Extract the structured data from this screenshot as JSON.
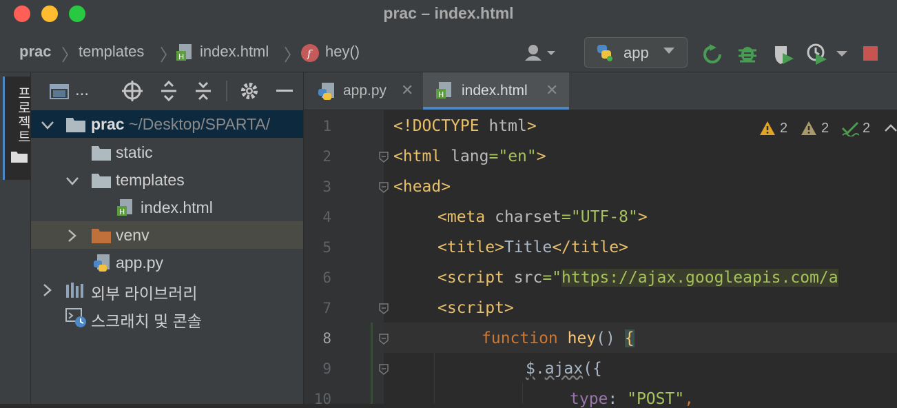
{
  "window": {
    "title": "prac – index.html"
  },
  "breadcrumb": {
    "project": "prac",
    "folder": "templates",
    "file": "index.html",
    "function": "hey()"
  },
  "run_config": {
    "label": "app"
  },
  "sidebar_strip": {
    "label": "프로젝트"
  },
  "project_panel": {
    "toolbar_dots": "...",
    "tree": [
      {
        "name": "prac",
        "path": "~/Desktop/SPARTA/"
      },
      {
        "name": "static"
      },
      {
        "name": "templates"
      },
      {
        "name": "index.html"
      },
      {
        "name": "venv"
      },
      {
        "name": "app.py"
      },
      {
        "name": "외부 라이브러리"
      },
      {
        "name": "스크래치 및 콘솔"
      }
    ]
  },
  "editor": {
    "tabs": [
      {
        "label": "app.py"
      },
      {
        "label": "index.html"
      }
    ],
    "inspections": {
      "warnings": "2",
      "weak_warnings": "2",
      "typos": "2"
    },
    "line_numbers": [
      "1",
      "2",
      "3",
      "4",
      "5",
      "6",
      "7",
      "8",
      "9",
      "10"
    ],
    "code": {
      "l1_a": "<!DOCTYPE ",
      "l1_b": "html",
      "l1_c": ">",
      "l2_a": "<html ",
      "l2_b": "lang",
      "l2_c": "=",
      "l2_d": "\"en\"",
      "l2_e": ">",
      "l3": "<head>",
      "l4_a": "<meta ",
      "l4_b": "charset",
      "l4_c": "=",
      "l4_d": "\"UTF-8\"",
      "l4_e": ">",
      "l5_a": "<title>",
      "l5_b": "Title",
      "l5_c": "</title>",
      "l6_a": "<script ",
      "l6_b": "src",
      "l6_c": "=\"",
      "l6_d": "https://ajax.googleapis.com/a",
      "l7": "<script>",
      "l8_a": "function ",
      "l8_b": "hey",
      "l8_c": "() ",
      "l8_d": "{",
      "l9_a": "$",
      "l9_b": ".",
      "l9_c": "ajax",
      "l9_d": "({",
      "l10_a": "type",
      "l10_b": ": ",
      "l10_c": "\"POST\"",
      "l10_d": ","
    }
  },
  "colors": {
    "accent": "#4a88c7",
    "warning": "#e0a427",
    "weak_warning": "#a89a6a",
    "typo_ok": "#4e9a4e",
    "stop": "#c75450"
  }
}
